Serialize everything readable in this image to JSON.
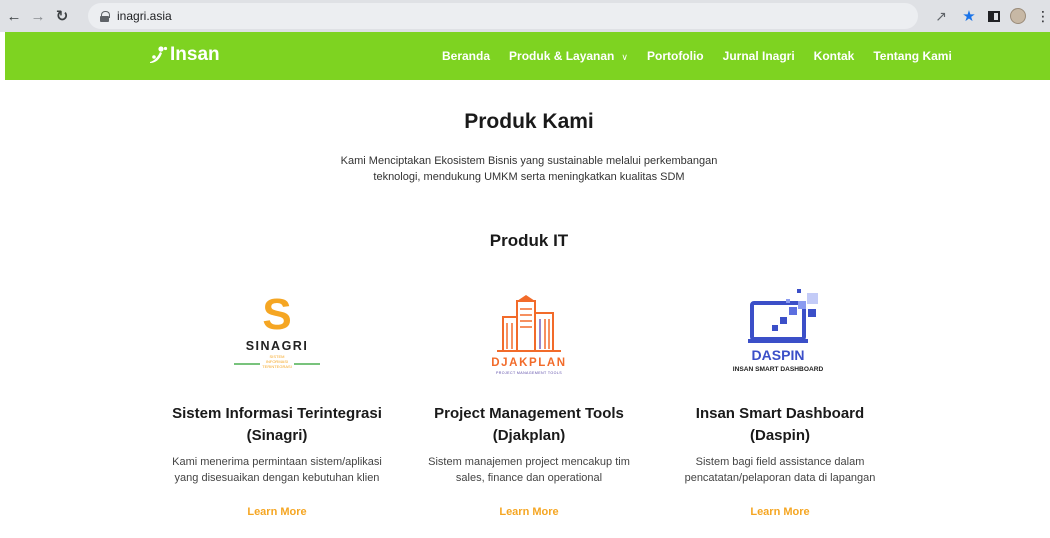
{
  "browser": {
    "url": "inagri.asia"
  },
  "site": {
    "logo_text": "Insan",
    "nav": [
      {
        "label": "Beranda"
      },
      {
        "label": "Produk & Layanan"
      },
      {
        "label": "Portofolio"
      },
      {
        "label": "Jurnal Inagri"
      },
      {
        "label": "Kontak"
      },
      {
        "label": "Tentang Kami"
      }
    ],
    "brand_color": "#7ED321",
    "accent_color": "#F5A623"
  },
  "main": {
    "title": "Produk Kami",
    "subtitle_line1": "Kami Menciptakan Ekosistem Bisnis yang sustainable melalui perkembangan",
    "subtitle_line2": "teknologi, mendukung UMKM serta meningkatkan kualitas SDM",
    "section_title": "Produk IT"
  },
  "products": [
    {
      "logo_letter": "S",
      "logo_name": "SINAGRI",
      "logo_tag1": "SISTEM",
      "logo_tag2": "INFORMASI",
      "logo_tag3": "TERINTEGRASI",
      "title1": "Sistem Informasi Terintegrasi",
      "title2": "(Sinagri)",
      "desc1": "Kami menerima permintaan sistem/aplikasi",
      "desc2": "yang disesuaikan dengan kebutuhan klien",
      "cta": "Learn More"
    },
    {
      "logo_name": "DJAKPLAN",
      "logo_tag": "PROJECT MANAGEMENT TOOLS",
      "title1": "Project Management Tools",
      "title2": "(Djakplan)",
      "desc1": "Sistem manajemen project mencakup tim",
      "desc2": "sales, finance dan operational",
      "cta": "Learn More"
    },
    {
      "logo_name": "DASPIN",
      "logo_tag": "INSAN SMART DASHBOARD",
      "title1": "Insan Smart Dashboard",
      "title2": "(Daspin)",
      "desc1": "Sistem bagi field assistance dalam",
      "desc2": "pencatatan/pelaporan data di lapangan",
      "cta": "Learn More"
    }
  ]
}
